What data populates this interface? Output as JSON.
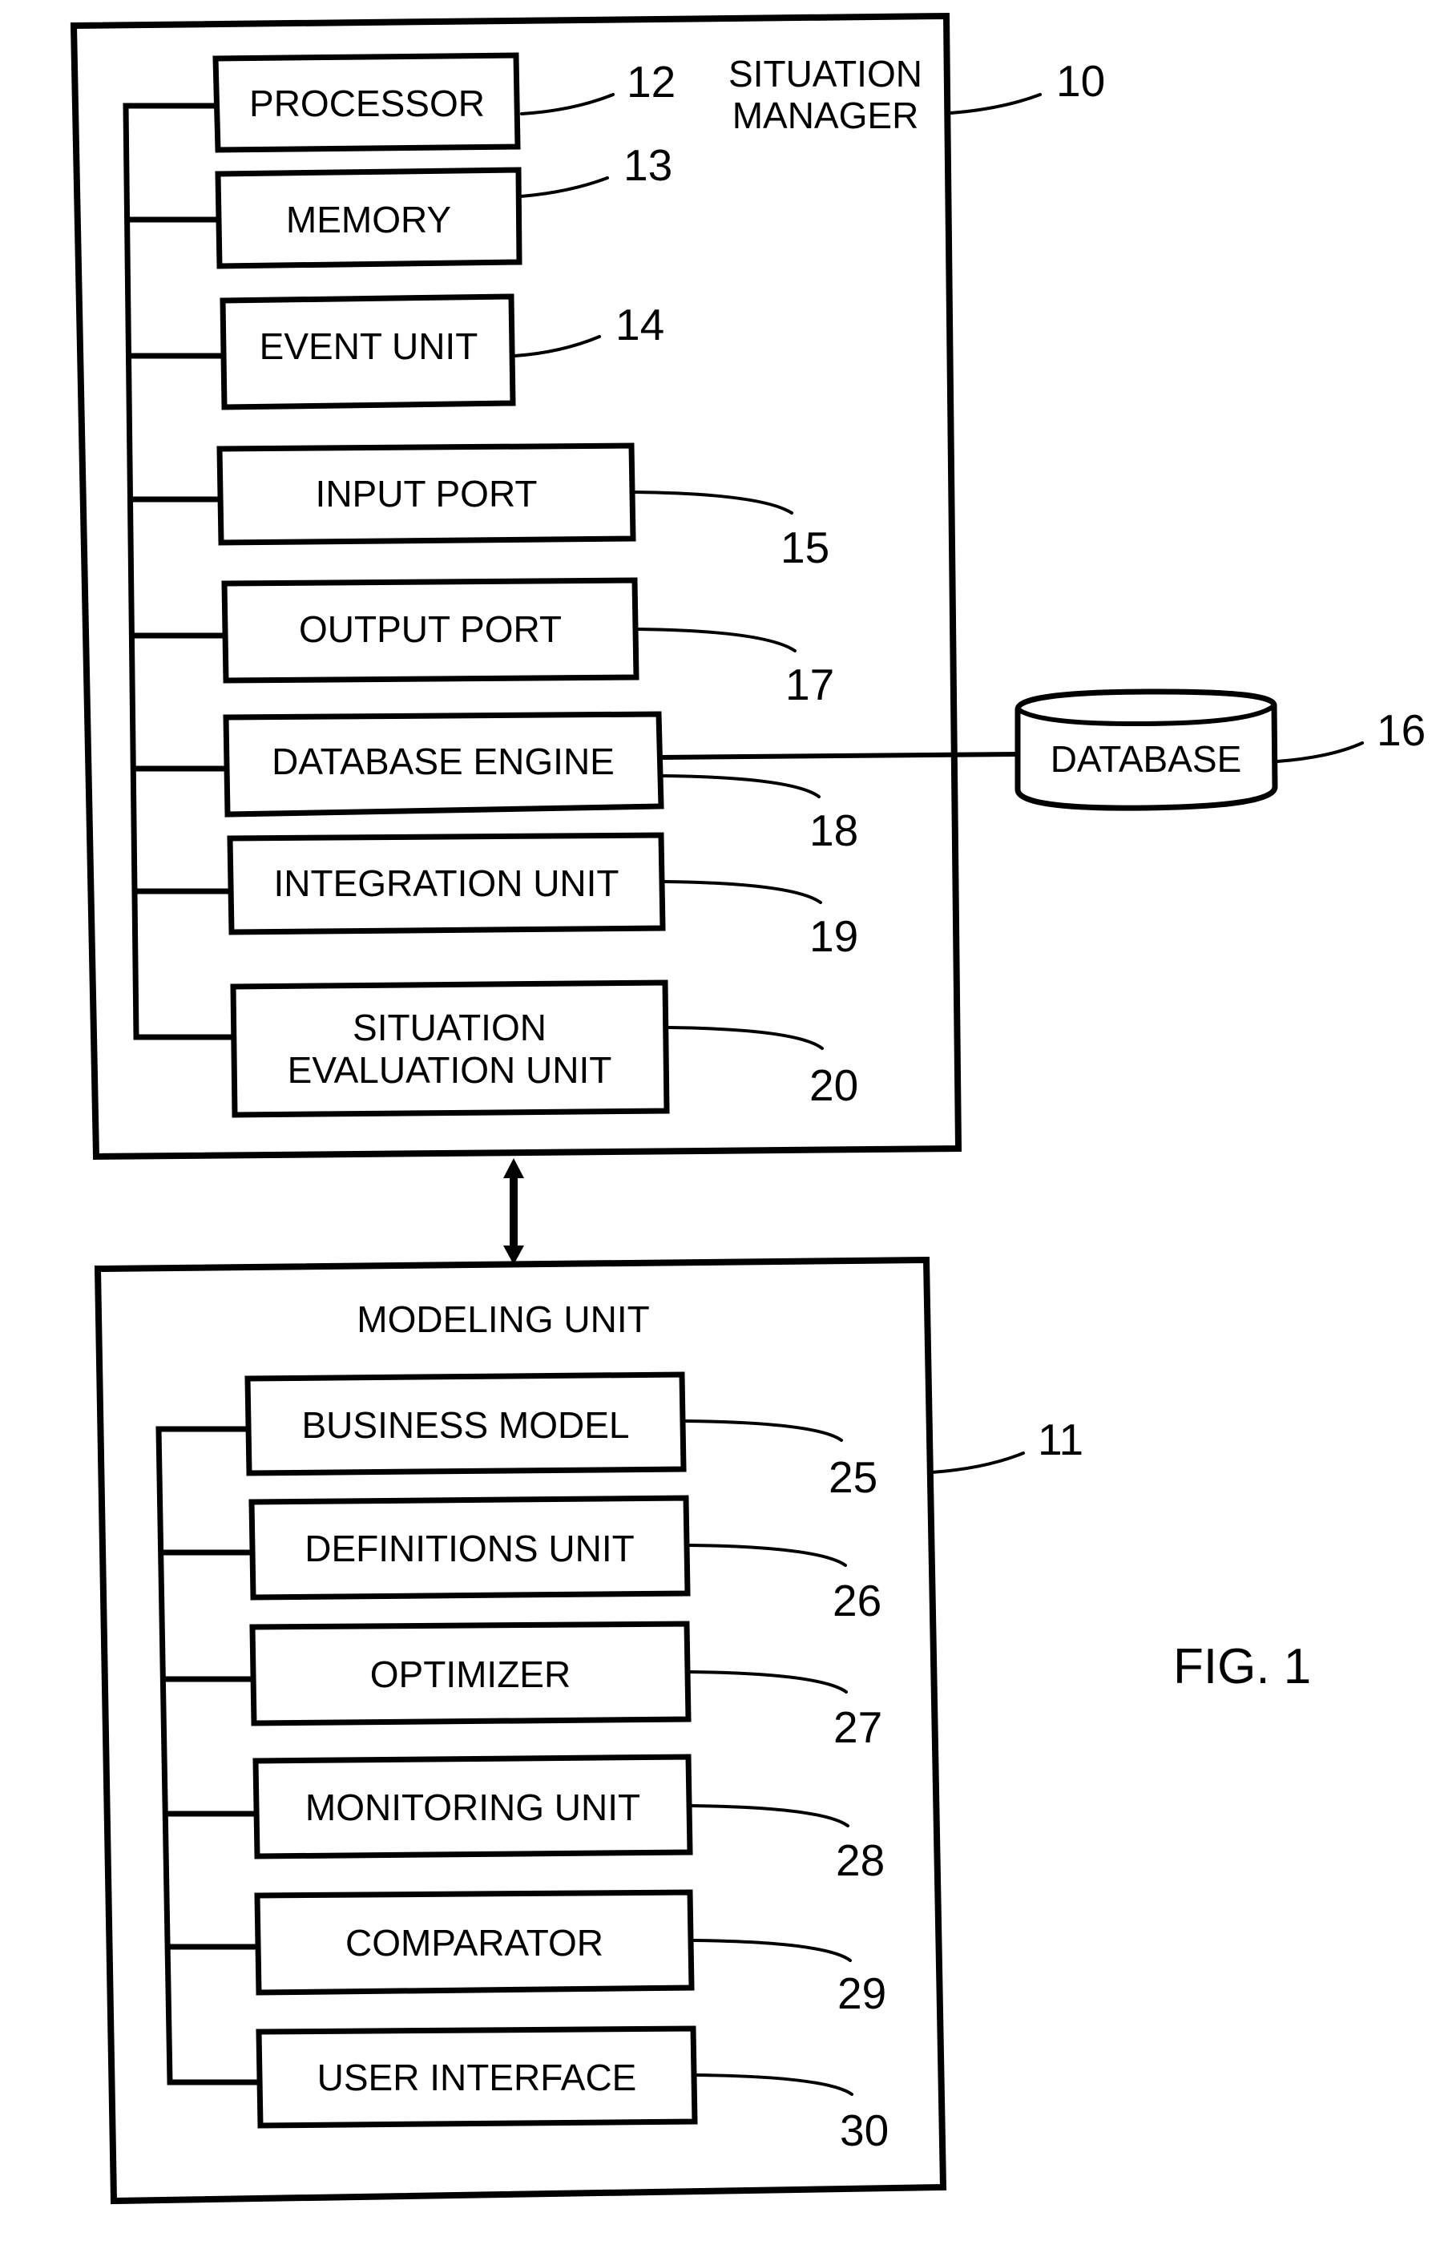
{
  "figure_label": "FIG. 1",
  "situation_manager": {
    "title_line1": "SITUATION",
    "title_line2": "MANAGER",
    "ref": "10",
    "components": [
      {
        "label": "PROCESSOR",
        "ref": "12"
      },
      {
        "label": "MEMORY",
        "ref": "13"
      },
      {
        "label": "EVENT UNIT",
        "ref": "14"
      },
      {
        "label": "INPUT PORT",
        "ref": "15"
      },
      {
        "label": "OUTPUT PORT",
        "ref": "17"
      },
      {
        "label": "DATABASE ENGINE",
        "ref": "18"
      },
      {
        "label": "INTEGRATION UNIT",
        "ref": "19"
      },
      {
        "label_line1": "SITUATION",
        "label_line2": "EVALUATION UNIT",
        "ref": "20"
      }
    ]
  },
  "database": {
    "label": "DATABASE",
    "ref": "16"
  },
  "modeling_unit": {
    "title": "MODELING UNIT",
    "ref": "11",
    "components": [
      {
        "label": "BUSINESS MODEL",
        "ref": "25"
      },
      {
        "label": "DEFINITIONS UNIT",
        "ref": "26"
      },
      {
        "label": "OPTIMIZER",
        "ref": "27"
      },
      {
        "label": "MONITORING UNIT",
        "ref": "28"
      },
      {
        "label": "COMPARATOR",
        "ref": "29"
      },
      {
        "label": "USER INTERFACE",
        "ref": "30"
      }
    ]
  },
  "connections": [
    {
      "from": "situation_manager",
      "to": "modeling_unit",
      "type": "bidirectional-arrow"
    },
    {
      "from": "DATABASE ENGINE",
      "to": "DATABASE",
      "type": "line"
    }
  ]
}
